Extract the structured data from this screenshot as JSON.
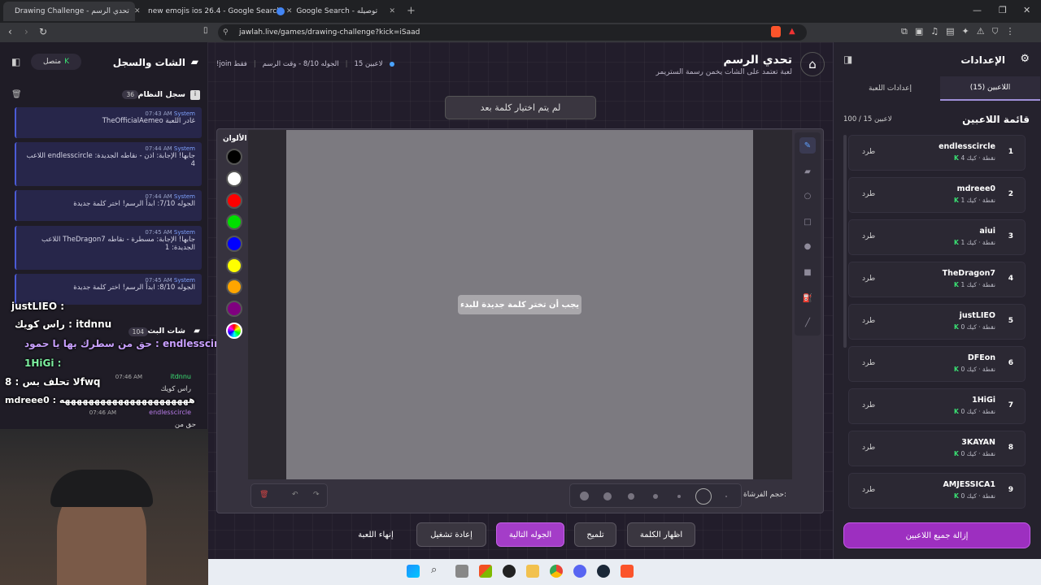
{
  "browser": {
    "tabs": [
      {
        "label": "Drawing Challenge - تحدي الرسم",
        "color": "#e35b5b"
      },
      {
        "label": "new emojis ios 26.4 - Google Search",
        "color": "#4285f4"
      },
      {
        "label": "Google Search - توصيله",
        "color": "#4285f4"
      }
    ],
    "url": "jawlah.live/games/drawing-challenge?kick=iSaad"
  },
  "chat_panel": {
    "title": "الشات والسجل",
    "status": "متصل",
    "system_log_label": "سجل النظام",
    "system_log_count": "36",
    "messages": [
      {
        "sender": "System",
        "time": "07:43 AM",
        "text": "TheOfficialAemeo غادر اللعبة"
      },
      {
        "sender": "System",
        "time": "07:44 AM",
        "text": "اللاعب endlesscircle جابها! الإجابة: اذن - نقاطه الجديدة: 4"
      },
      {
        "sender": "System",
        "time": "07:44 AM",
        "text": "الجوله 7/10: ابدأ الرسم! اختر كلمة جديدة"
      },
      {
        "sender": "System",
        "time": "07:45 AM",
        "text": "اللاعب TheDragon7 جابها! الإجابة: مسطرة - نقاطه الجديدة: 1"
      },
      {
        "sender": "System",
        "time": "07:45 AM",
        "text": "الجوله 8/10: ابدأ الرسم! اختر كلمة جديدة"
      }
    ],
    "stream_chat_label": "شات البث",
    "stream_chat_count": "104",
    "chat_messages": [
      {
        "user": "itdnnu",
        "time": "07:46 AM",
        "text": "راس كويك"
      },
      {
        "user": "endlesscircle",
        "time": "07:46 AM",
        "text": "حق من"
      }
    ],
    "overlay_lines": [
      "justLIEO :",
      "راس كويك : itdnnu",
      "حق من سطرك بها يا حمود : endlesscircle",
      "1HiGi :",
      "لا تحلف بس : 8fwq",
      "mdreee0 : ههههههههههههههههههههههه"
    ]
  },
  "game": {
    "title": "تحدي الرسم",
    "subtitle": "لعبة تعتمد على الشات يخمن رسمة الستريمر",
    "players_online": "15 لاعبين",
    "round_info": "الجوله 8/10 - وقت الرسم",
    "join_hint": "!join فقط",
    "word_status": "لم يتم اختيار كلمة بعد",
    "canvas_hint": "يجب أن تختر كلمة جديدة للبدء",
    "colors_label": "الألوان",
    "colors": [
      "#000000",
      "#ffffff",
      "#ff0000",
      "#00dd00",
      "#0000ff",
      "#ffff00",
      "#ffa500",
      "#800080"
    ],
    "brush_size_label": "حجم الفرشاة:",
    "buttons": {
      "show_word": "اظهار الكلمة",
      "hint": "تلميح",
      "next_round": "الجوله التالية",
      "restart": "إعادة تشغيل",
      "end_game": "إنهاء اللعبة"
    }
  },
  "settings_panel": {
    "title": "الإعدادات",
    "tab_players": "اللاعبين (15)",
    "tab_game_settings": "إعدادات اللعبة",
    "player_list_title": "قائمة اللاعبين",
    "player_count": "100 / 15 لاعبين",
    "kick_label": "طرد",
    "players": [
      {
        "rank": "1",
        "name": "endlesscircle",
        "score": "4 نقطة · كيك"
      },
      {
        "rank": "2",
        "name": "mdreee0",
        "score": "1 نقطة · كيك"
      },
      {
        "rank": "3",
        "name": "aiui",
        "score": "1 نقطة · كيك"
      },
      {
        "rank": "4",
        "name": "TheDragon7",
        "score": "1 نقطة · كيك"
      },
      {
        "rank": "5",
        "name": "justLIEO",
        "score": "0 نقطة · كيك"
      },
      {
        "rank": "6",
        "name": "DFEon",
        "score": "0 نقطة · كيك"
      },
      {
        "rank": "7",
        "name": "1HiGi",
        "score": "0 نقطة · كيك"
      },
      {
        "rank": "8",
        "name": "3KAYAN",
        "score": "0 نقطة · كيك"
      },
      {
        "rank": "9",
        "name": "AMJESSICA1",
        "score": "0 نقطة · كيك"
      }
    ],
    "clear_button": "إزالة جميع اللاعبين"
  },
  "taskbar": {
    "icons": [
      "windows-icon",
      "search-icon",
      "file-explorer-icon",
      "store-icon",
      "obs-icon",
      "folder-icon",
      "chrome-icon",
      "discord-icon",
      "steam-icon",
      "brave-icon"
    ]
  }
}
